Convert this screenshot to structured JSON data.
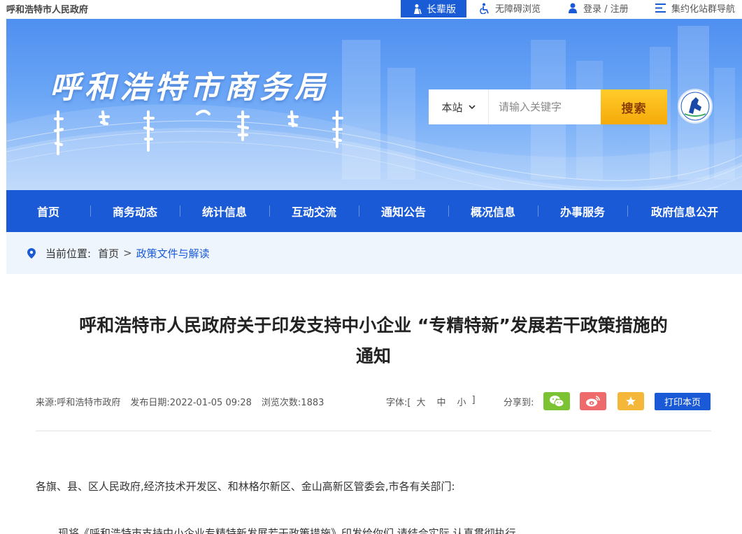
{
  "topbar": {
    "site_name": "呼和浩特市人民政府",
    "elder_mode": "长辈版",
    "accessibility": "无障碍浏览",
    "login": "登录 / 注册",
    "site_group": "集约化站群导航"
  },
  "banner": {
    "title": "呼和浩特市商务局",
    "search": {
      "scope": "本站",
      "placeholder": "请输入关键字",
      "button": "搜索"
    }
  },
  "nav": {
    "items": [
      {
        "label": "首页"
      },
      {
        "label": "商务动态"
      },
      {
        "label": "统计信息"
      },
      {
        "label": "互动交流"
      },
      {
        "label": "通知公告"
      },
      {
        "label": "概况信息"
      },
      {
        "label": "办事服务"
      },
      {
        "label": "政府信息公开"
      }
    ]
  },
  "breadcrumb": {
    "prefix": "当前位置:",
    "home": "首页",
    "separator": ">",
    "current": "政策文件与解读"
  },
  "article": {
    "title_line1": "呼和浩特市人民政府关于印发支持中小企业 “专精特新”发展若干政策措施的",
    "title_line2": "通知",
    "source": "来源:呼和浩特市政府",
    "date": "发布日期:2022-01-05 09:28",
    "views": "浏览次数:1883",
    "font_label": "字体:[",
    "font_large": "大",
    "font_medium": "中",
    "font_small": "小",
    "font_close": "]",
    "share_label": "分享到:",
    "print": "打印本页",
    "paragraph1": "各旗、县、区人民政府,经济技术开发区、和林格尔新区、金山高新区管委会,市各有关部门:",
    "paragraph2": "现将《呼和浩特市支持中小企业专精特新发展若干政策措施》印发给你们,请结合实际,认真贯彻执行。"
  },
  "colors": {
    "primary": "#1b5ad6",
    "search_button": "#f5aa0a",
    "wechat": "#7cc334",
    "weibo": "#ef6b6b",
    "favorite": "#f5b73a",
    "breadcrumb_bg": "#eef5fd"
  }
}
